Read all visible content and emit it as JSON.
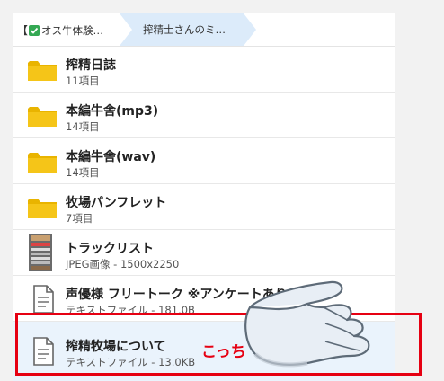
{
  "breadcrumb": {
    "item1_bracket": "【",
    "item1_label": "オス牛体験…",
    "item2_label": "搾精士さんのミ…"
  },
  "files": [
    {
      "name": "搾精日誌",
      "meta": "11項目",
      "type": "folder-icon"
    },
    {
      "name": "本編牛舎(mp3)",
      "meta": "14項目",
      "type": "folder-icon"
    },
    {
      "name": "本編牛舎(wav)",
      "meta": "14項目",
      "type": "folder-icon"
    },
    {
      "name": "牧場パンフレット",
      "meta": "7項目",
      "type": "folder-icon"
    },
    {
      "name": "トラックリスト",
      "meta": "JPEG画像 - 1500x2250",
      "type": "image-thumbnail"
    },
    {
      "name": "声優様 フリートーク ※アンケートあり",
      "meta": "テキストファイル - 181.0B",
      "type": "text-file-icon"
    },
    {
      "name": "搾精牧場について",
      "meta": "テキストファイル - 13.0KB",
      "type": "text-file-icon"
    }
  ],
  "annotation": {
    "label": "こっち",
    "color": "#e60012",
    "pointer": "pointing-hand-icon"
  },
  "colors": {
    "folder": "#f5c518",
    "active_row": "#eaf3fc",
    "breadcrumb_active": "#dcebfa",
    "check": "#34a853"
  }
}
